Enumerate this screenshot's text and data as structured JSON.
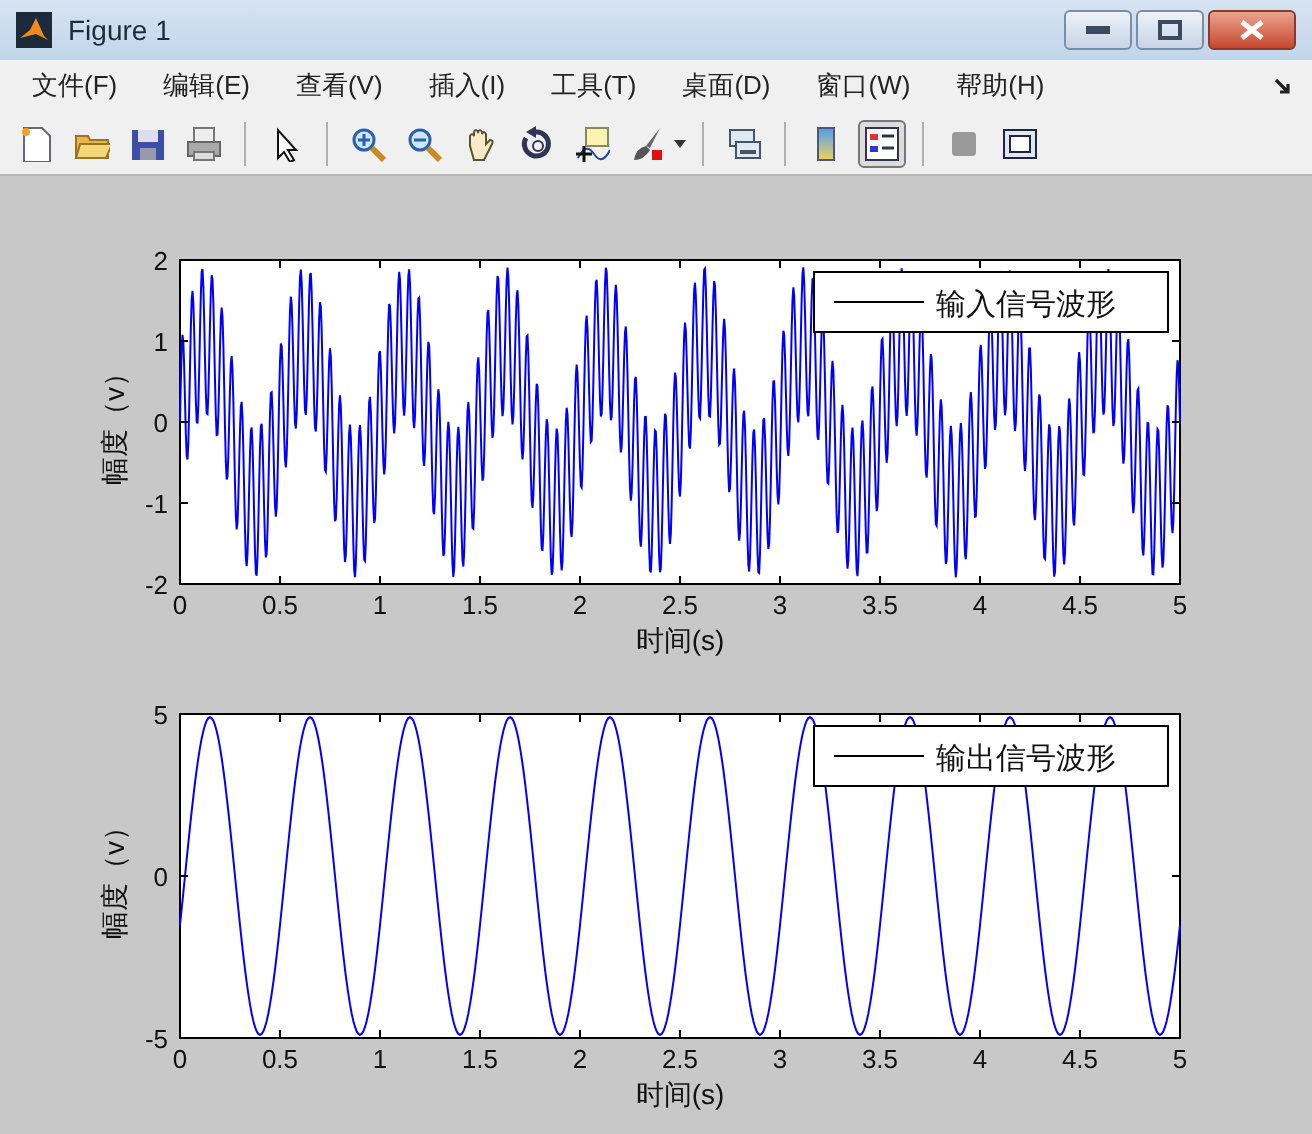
{
  "window": {
    "title": "Figure 1"
  },
  "menu": [
    "文件(F)",
    "编辑(E)",
    "查看(V)",
    "插入(I)",
    "工具(T)",
    "桌面(D)",
    "窗口(W)",
    "帮助(H)"
  ],
  "toolbar": [
    {
      "kind": "new",
      "selected": false
    },
    {
      "kind": "open",
      "selected": false
    },
    {
      "kind": "save",
      "selected": false
    },
    {
      "kind": "print",
      "selected": false
    },
    {
      "kind": "separator"
    },
    {
      "kind": "pointer",
      "selected": false
    },
    {
      "kind": "separator"
    },
    {
      "kind": "zoomin",
      "selected": false
    },
    {
      "kind": "zoomout",
      "selected": false
    },
    {
      "kind": "pan",
      "selected": false
    },
    {
      "kind": "rotate",
      "selected": false
    },
    {
      "kind": "datacursor",
      "selected": false
    },
    {
      "kind": "brush",
      "selected": false
    },
    {
      "kind": "separator"
    },
    {
      "kind": "link",
      "selected": false
    },
    {
      "kind": "separator"
    },
    {
      "kind": "colorbar",
      "selected": false
    },
    {
      "kind": "legend",
      "selected": true
    },
    {
      "kind": "separator"
    },
    {
      "kind": "square",
      "selected": false
    },
    {
      "kind": "frame",
      "selected": false
    }
  ],
  "plots": [
    {
      "kind": "input",
      "xlabel": "时间(s)",
      "ylabel": "幅度（v）",
      "xticks": [
        "0",
        "0.5",
        "1",
        "1.5",
        "2",
        "2.5",
        "3",
        "3.5",
        "4",
        "4.5",
        "5"
      ],
      "yticks": [
        "2",
        "1",
        "0",
        "-1",
        "-2"
      ],
      "legend": "输入信号波形"
    },
    {
      "kind": "output",
      "xlabel": "时间(s)",
      "ylabel": "幅度（v）",
      "xticks": [
        "0",
        "0.5",
        "1",
        "1.5",
        "2",
        "2.5",
        "3",
        "3.5",
        "4",
        "4.5",
        "5"
      ],
      "yticks": [
        "5",
        "0",
        "-5"
      ],
      "legend": "输出信号波形"
    }
  ]
}
